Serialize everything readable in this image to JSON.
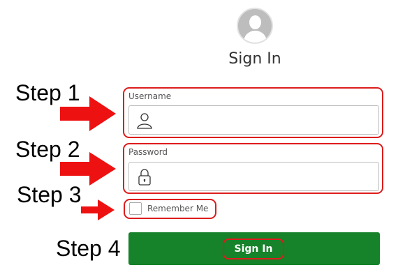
{
  "header": {
    "title": "Sign In",
    "avatar_icon": "user-avatar-icon"
  },
  "steps": [
    {
      "label": "Step 1"
    },
    {
      "label": "Step 2"
    },
    {
      "label": "Step 3"
    },
    {
      "label": "Step 4"
    }
  ],
  "form": {
    "username": {
      "label": "Username",
      "value": "",
      "icon": "user-icon"
    },
    "password": {
      "label": "Password",
      "value": "",
      "icon": "lock-icon"
    },
    "remember": {
      "label": "Remember Me",
      "checked": false
    },
    "submit_label": "Sign In"
  },
  "colors": {
    "annotation_red": "#dd1c1c",
    "button_green": "#16822a"
  }
}
